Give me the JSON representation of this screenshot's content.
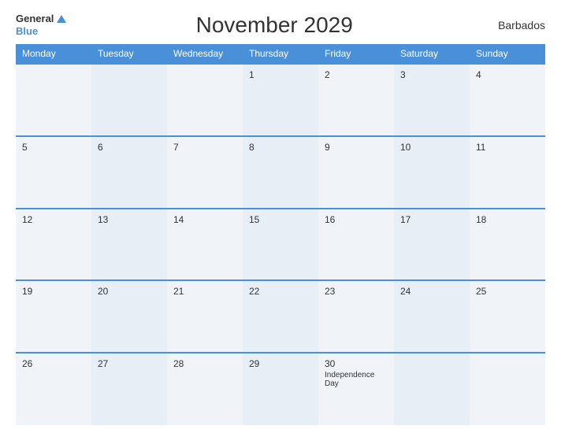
{
  "header": {
    "title": "November 2029",
    "country": "Barbados",
    "logo": {
      "general": "General",
      "blue": "Blue"
    }
  },
  "weekdays": [
    "Monday",
    "Tuesday",
    "Wednesday",
    "Thursday",
    "Friday",
    "Saturday",
    "Sunday"
  ],
  "weeks": [
    [
      {
        "day": "",
        "event": ""
      },
      {
        "day": "",
        "event": ""
      },
      {
        "day": "",
        "event": ""
      },
      {
        "day": "1",
        "event": ""
      },
      {
        "day": "2",
        "event": ""
      },
      {
        "day": "3",
        "event": ""
      },
      {
        "day": "4",
        "event": ""
      }
    ],
    [
      {
        "day": "5",
        "event": ""
      },
      {
        "day": "6",
        "event": ""
      },
      {
        "day": "7",
        "event": ""
      },
      {
        "day": "8",
        "event": ""
      },
      {
        "day": "9",
        "event": ""
      },
      {
        "day": "10",
        "event": ""
      },
      {
        "day": "11",
        "event": ""
      }
    ],
    [
      {
        "day": "12",
        "event": ""
      },
      {
        "day": "13",
        "event": ""
      },
      {
        "day": "14",
        "event": ""
      },
      {
        "day": "15",
        "event": ""
      },
      {
        "day": "16",
        "event": ""
      },
      {
        "day": "17",
        "event": ""
      },
      {
        "day": "18",
        "event": ""
      }
    ],
    [
      {
        "day": "19",
        "event": ""
      },
      {
        "day": "20",
        "event": ""
      },
      {
        "day": "21",
        "event": ""
      },
      {
        "day": "22",
        "event": ""
      },
      {
        "day": "23",
        "event": ""
      },
      {
        "day": "24",
        "event": ""
      },
      {
        "day": "25",
        "event": ""
      }
    ],
    [
      {
        "day": "26",
        "event": ""
      },
      {
        "day": "27",
        "event": ""
      },
      {
        "day": "28",
        "event": ""
      },
      {
        "day": "29",
        "event": ""
      },
      {
        "day": "30",
        "event": "Independence Day"
      },
      {
        "day": "",
        "event": ""
      },
      {
        "day": "",
        "event": ""
      }
    ]
  ]
}
